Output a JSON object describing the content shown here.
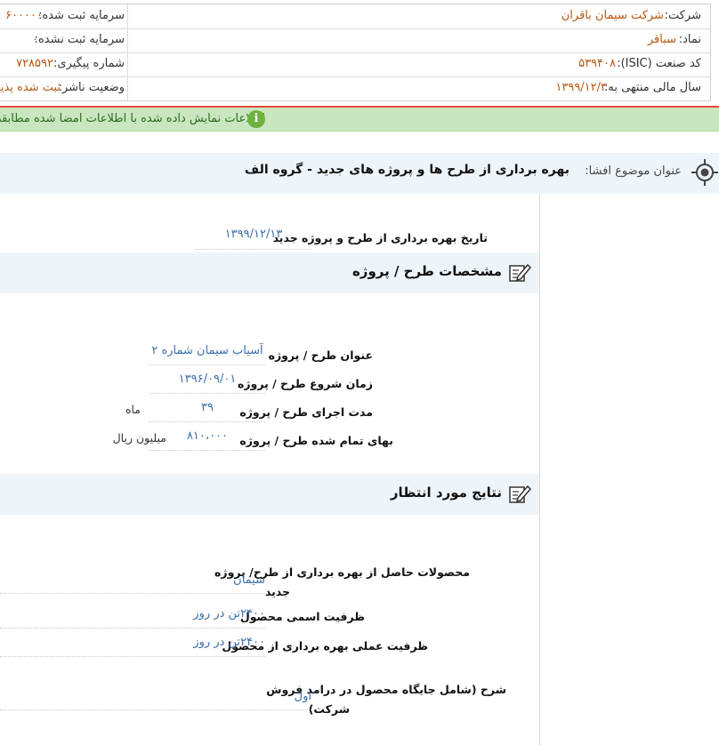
{
  "header": {
    "company_label": "شرکت:",
    "company_value": "شرکت سیمان باقران",
    "symbol_label": "نماد:",
    "symbol_value": "سباقر",
    "isic_label": "کد صنعت (ISIC):",
    "isic_value": "۵۳۹۴۰۸",
    "fiscal_label": "سال مالی منتهی به:",
    "fiscal_value": "۱۳۹۹/۱۲/۳۰",
    "reg_capital_label": "سرمایه ثبت شده:",
    "reg_capital_value": "۶۰۰۰۰۰",
    "unreg_capital_label": "سرمایه ثبت نشده:",
    "unreg_capital_value": "۰",
    "tracking_label": "شماره پیگیری:",
    "tracking_value": "۷۲۸۵۹۲",
    "status_label": "وضعیت ناشر:",
    "status_value": "ثبت شده پذیرفت"
  },
  "notice": {
    "text": "اطلاعات نمایش داده شده با اطلاعات امضا شده مطابقت دار",
    "icon": "info-icon",
    "icon_glyph": "i"
  },
  "topic": {
    "label": "عنوان موضوع افشا:",
    "title": "بهره برداری از طرح ها و پروژه های جدید - گروه الف",
    "icon": "target-icon"
  },
  "exploitation_date": {
    "label": "تاریخ بهره برداری از طرح و پروژه جدید",
    "value": "۱۳۹۹/۱۲/۱۳"
  },
  "project_section": {
    "title": "مشخصات طرح / پروژه",
    "icon": "edit-icon",
    "fields": [
      {
        "label": "عنوان طرح / پروژه",
        "value": "آسیاب سیمان شماره ۲",
        "unit": ""
      },
      {
        "label": "زمان شروع طرح / پروژه",
        "value": "۱۳۹۶/۰۹/۰۱",
        "unit": ""
      },
      {
        "label": "مدت اجرای طرح / پروژه",
        "value": "۳۹",
        "unit": "ماه"
      },
      {
        "label": "بهای تمام شده طرح / پروژه",
        "value": "۸۱۰،۰۰۰",
        "unit": "میلیون ریال"
      }
    ]
  },
  "results_section": {
    "title": "نتایج مورد انتظار",
    "icon": "edit-icon",
    "products_label_line1": "محصولات حاصل از بهره برداری از طرح/ پروژه",
    "products_label_line2": "جدید",
    "products_value": "سیمان",
    "nominal_label": "ظرفیت اسمی محصول",
    "nominal_value": "۲۴۰۰تن در روز",
    "actual_label": "ظرفیت عملی بهره برداری از محصول",
    "actual_value": "۲۴۰۰تن در روز",
    "desc_label_line1": "شرح (شامل جایگاه محصول در درامد فروش",
    "desc_label_line2": "شرکت)",
    "desc_value": "اول"
  },
  "colors": {
    "accent_orange": "#b8560f",
    "link_blue": "#3a6fa8",
    "notice_green": "#c9e6c0",
    "section_bg": "#eef5fa",
    "red_line": "#e34a3a"
  }
}
